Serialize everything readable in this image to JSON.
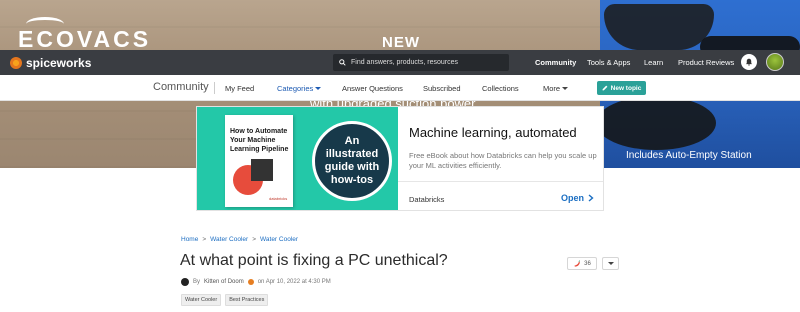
{
  "hero_ad": {
    "brand_logo": "ECOVACS",
    "headline": "NEW",
    "tagline": "with upgraded suction power",
    "feature": "Includes Auto-Empty Station"
  },
  "topnav": {
    "brand": "spiceworks",
    "search_placeholder": "Find answers, products, resources",
    "items": [
      "Community",
      "Tools & Apps",
      "Learn",
      "Product Reviews"
    ],
    "active": "Community",
    "bell_icon": "bell-icon",
    "avatar_icon": "user-avatar"
  },
  "subnav": {
    "section": "Community",
    "items": [
      "My Feed",
      "Categories",
      "Answer Questions",
      "Subscribed",
      "Collections",
      "More"
    ],
    "active": "Categories",
    "new_topic": "New topic"
  },
  "ad": {
    "book_title": "How to Automate Your Machine Learning Pipeline",
    "book_brand": "databricks",
    "circle_text": "An illustrated guide with how-tos",
    "title": "Machine learning, automated",
    "description": "Free eBook about how Databricks can help you scale up your ML activities efficiently.",
    "sponsor": "Databricks",
    "cta": "Open"
  },
  "post": {
    "breadcrumb": [
      "Home",
      "Water Cooler",
      "Water Cooler"
    ],
    "title": "At what point is fixing a PC unethical?",
    "byline_prefix": "By",
    "author": "Kitten of Doom",
    "date": "on Apr 10, 2022 at 4:30 PM",
    "tags": [
      "Water Cooler",
      "Best Practices"
    ],
    "pepper_count": "36"
  },
  "colors": {
    "accent": "#2aa198",
    "nav_bg": "#3a3d42",
    "link": "#1d6ec2"
  }
}
